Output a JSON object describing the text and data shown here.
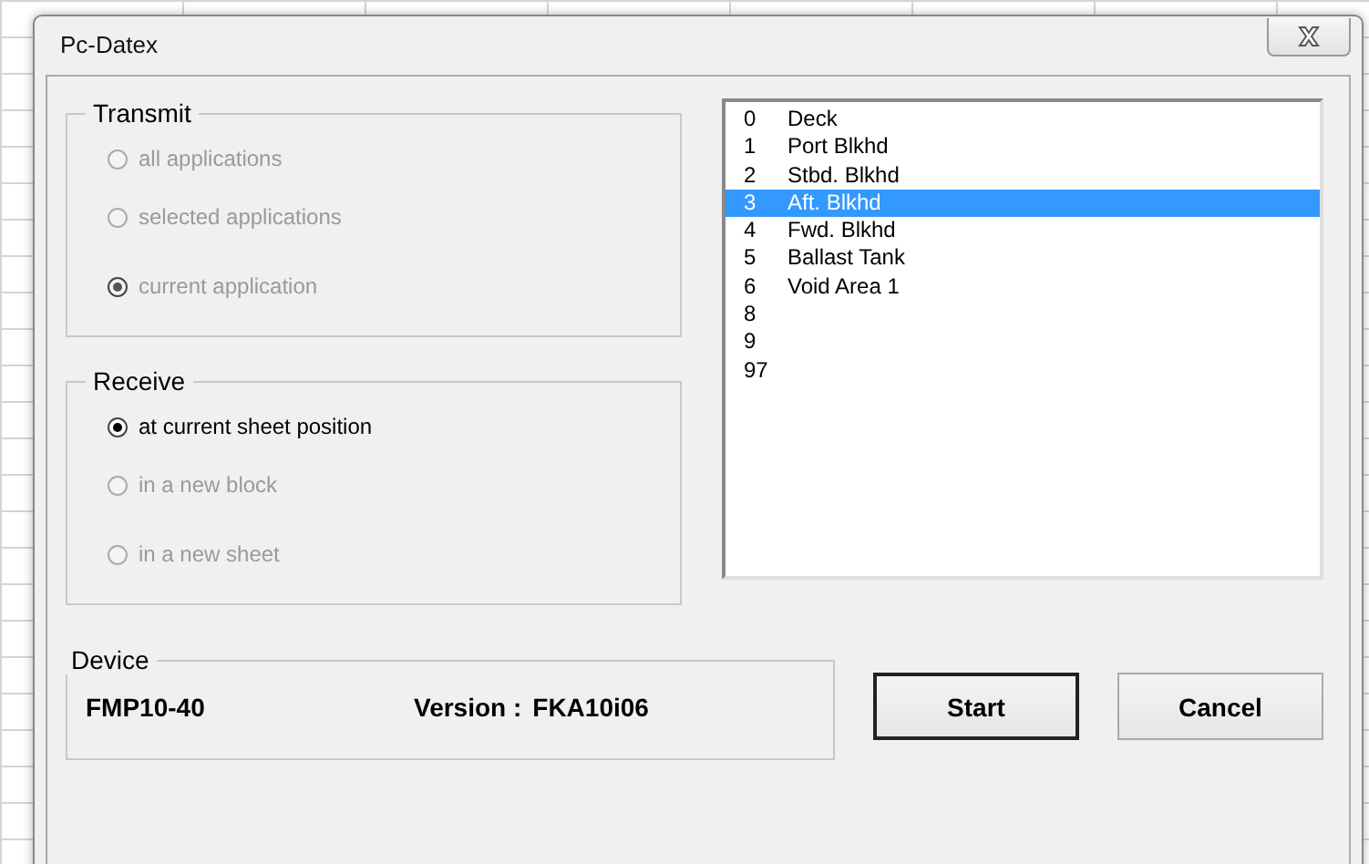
{
  "window": {
    "title": "Pc-Datex"
  },
  "transmit": {
    "label": "Transmit",
    "options": [
      {
        "label": "all applications",
        "selected": false,
        "disabled": true
      },
      {
        "label": "selected applications",
        "selected": false,
        "disabled": true
      },
      {
        "label": "current application",
        "selected": true,
        "disabled": true
      }
    ]
  },
  "receive": {
    "label": "Receive",
    "options": [
      {
        "label": "at current sheet position",
        "selected": true,
        "disabled": false
      },
      {
        "label": "in a new block",
        "selected": false,
        "disabled": true
      },
      {
        "label": "in a new sheet",
        "selected": false,
        "disabled": true
      }
    ]
  },
  "list": {
    "items": [
      {
        "number": "0",
        "name": "Deck",
        "selected": false
      },
      {
        "number": "1",
        "name": "Port Blkhd",
        "selected": false
      },
      {
        "number": "2",
        "name": "Stbd. Blkhd",
        "selected": false
      },
      {
        "number": "3",
        "name": "Aft. Blkhd",
        "selected": true
      },
      {
        "number": "4",
        "name": "Fwd. Blkhd",
        "selected": false
      },
      {
        "number": "5",
        "name": "Ballast Tank",
        "selected": false
      },
      {
        "number": "6",
        "name": "Void Area 1",
        "selected": false
      },
      {
        "number": "8",
        "selected": false
      },
      {
        "number": "9",
        "selected": false
      },
      {
        "number": "97",
        "selected": false
      }
    ]
  },
  "device": {
    "label": "Device",
    "model": "FMP10-40",
    "version_label": "Version :",
    "version": "FKA10i06"
  },
  "buttons": [
    {
      "label": "Start",
      "default": true
    },
    {
      "label": "Cancel",
      "default": false
    }
  ]
}
